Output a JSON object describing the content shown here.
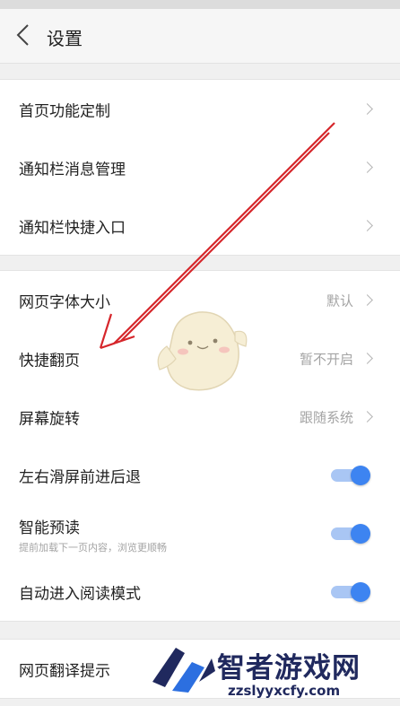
{
  "statusbar": {
    "carrier": "",
    "clock": ""
  },
  "header": {
    "title": "设置"
  },
  "group1": {
    "items": [
      {
        "label": "首页功能定制"
      },
      {
        "label": "通知栏消息管理"
      },
      {
        "label": "通知栏快捷入口"
      }
    ]
  },
  "group2": {
    "items": [
      {
        "label": "网页字体大小",
        "value": "默认"
      },
      {
        "label": "快捷翻页",
        "value": "暂不开启"
      },
      {
        "label": "屏幕旋转",
        "value": "跟随系统"
      },
      {
        "label": "左右滑屏前进后退",
        "toggle": true
      },
      {
        "label": "智能预读",
        "sub": "提前加载下一页内容，浏览更顺畅",
        "toggle": true
      },
      {
        "label": "自动进入阅读模式",
        "toggle": true
      }
    ]
  },
  "group3": {
    "items": [
      {
        "label": "网页翻译提示"
      }
    ]
  },
  "watermark": {
    "name": "智者游戏网",
    "url": "zzslyyxcfy.com"
  },
  "colors": {
    "toggle_on": "#3d84f1",
    "toggle_track": "#a9c6f4",
    "annotation_arrow": "#d6262b",
    "watermark": "#20295e"
  },
  "icons": [
    "back-icon",
    "chevron-right-icon",
    "toggle-switch",
    "annotation-arrow",
    "mascot-sticker",
    "watermark-logo"
  ]
}
